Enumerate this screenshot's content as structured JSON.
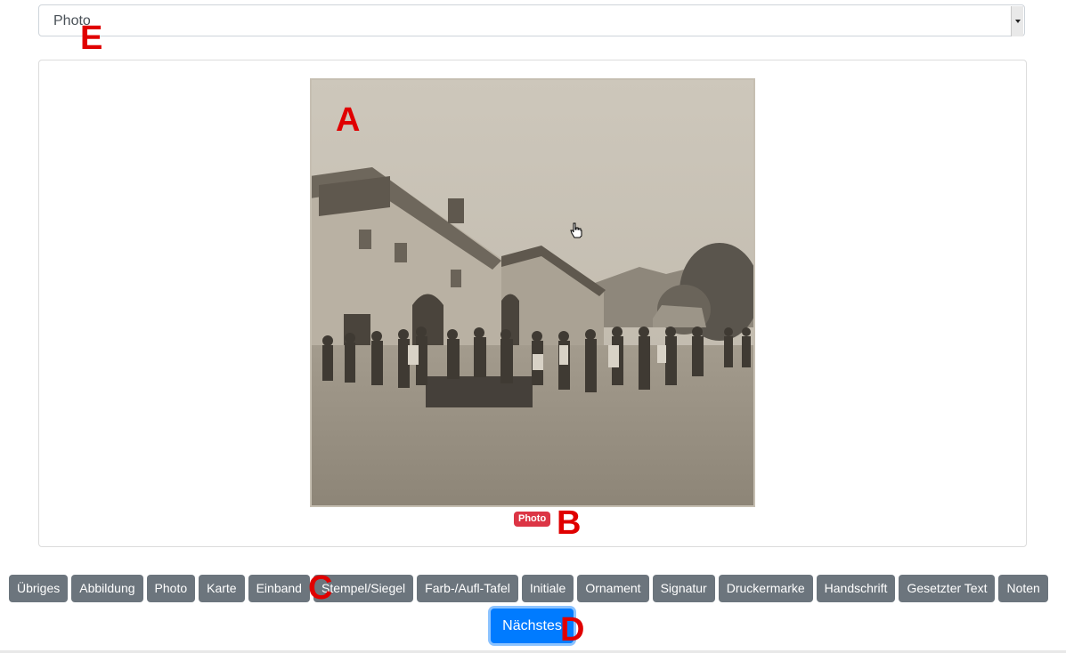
{
  "type_select": {
    "value": "Photo"
  },
  "image": {
    "description_icon": "historic-photo"
  },
  "badge": {
    "label": "Photo",
    "color": "#dc3545"
  },
  "markers": {
    "a": "A",
    "b": "B",
    "c": "C",
    "d": "D",
    "e": "E"
  },
  "categories": [
    "Übriges",
    "Abbildung",
    "Photo",
    "Karte",
    "Einband",
    "Stempel/Siegel",
    "Farb-/Aufl-Tafel",
    "Initiale",
    "Ornament",
    "Signatur",
    "Druckermarke",
    "Handschrift",
    "Gesetzter Text",
    "Noten"
  ],
  "next_button": {
    "label": "Nächstes",
    "color": "#007bff"
  },
  "colors": {
    "category_button": "#6c757d",
    "marker": "#e00000"
  }
}
